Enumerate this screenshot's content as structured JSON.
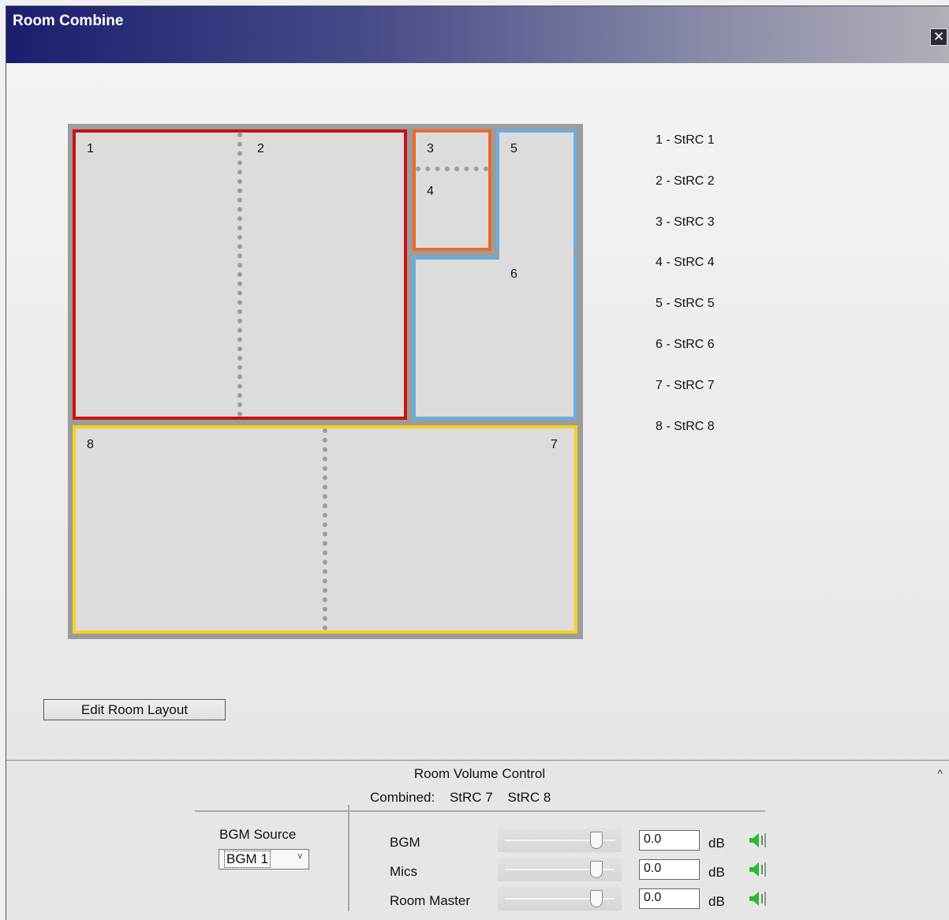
{
  "window": {
    "title": "Room Combine",
    "close_symbol": "✕"
  },
  "rooms": [
    {
      "id": "1"
    },
    {
      "id": "2"
    },
    {
      "id": "3"
    },
    {
      "id": "4"
    },
    {
      "id": "5"
    },
    {
      "id": "6"
    },
    {
      "id": "7"
    },
    {
      "id": "8"
    }
  ],
  "group_colors": {
    "red": "#cc1111",
    "orange": "#f06a28",
    "blue": "#6aaee0",
    "yellow": "#f5d21a"
  },
  "legend": [
    "1 - StRC 1",
    "2 - StRC 2",
    "3 - StRC 3",
    "4 - StRC 4",
    "5 - StRC 5",
    "6 - StRC 6",
    "7 - StRC 7",
    "8 - StRC 8"
  ],
  "edit_button": "Edit Room Layout",
  "volume_panel": {
    "title": "Room Volume Control",
    "collapse_symbol": "^",
    "combined_label": "Combined:",
    "combined_rooms": [
      "StRC 7",
      "StRC 8"
    ],
    "bgm_source_label": "BGM Source",
    "bgm_source_value": "BGM 1",
    "rows": [
      {
        "label": "BGM",
        "value": "0.0",
        "unit": "dB",
        "slider_level": 0.8
      },
      {
        "label": "Mics",
        "value": "0.0",
        "unit": "dB",
        "slider_level": 0.8
      },
      {
        "label": "Room Master",
        "value": "0.0",
        "unit": "dB",
        "slider_level": 0.8
      }
    ],
    "speaker_icon": "speaker-icon"
  }
}
